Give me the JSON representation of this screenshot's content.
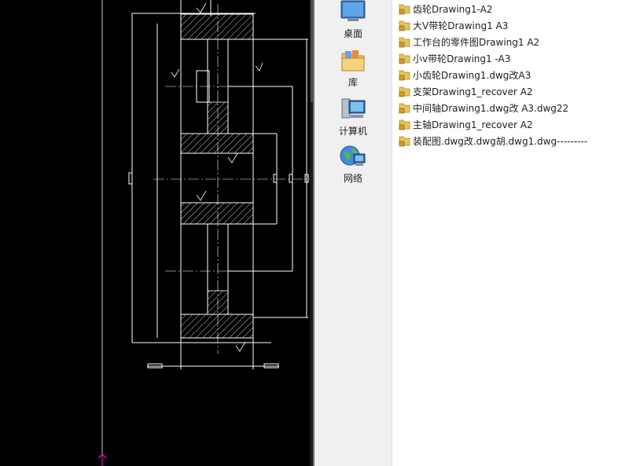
{
  "nav": {
    "items": [
      {
        "label": "桌面",
        "icon": "desktop-icon"
      },
      {
        "label": "库",
        "icon": "library-icon"
      },
      {
        "label": "计算机",
        "icon": "computer-icon"
      },
      {
        "label": "网络",
        "icon": "network-icon"
      }
    ]
  },
  "files": {
    "items": [
      {
        "label": "齿轮Drawing1-A2"
      },
      {
        "label": "大V带轮Drawing1 A3"
      },
      {
        "label": "工作台的零件图Drawing1 A2"
      },
      {
        "label": "小v带轮Drawing1 -A3"
      },
      {
        "label": "小齿轮Drawing1.dwg改A3"
      },
      {
        "label": "支架Drawing1_recover A2"
      },
      {
        "label": "中间轴Drawing1.dwg改 A3.dwg22"
      },
      {
        "label": "主轴Drawing1_recover A2"
      },
      {
        "label": "装配图.dwg改.dwg胡.dwg1.dwg---------"
      }
    ]
  },
  "colors": {
    "cad_background": "#000000",
    "cad_lines": "#ffffff",
    "ucs_marker": "#ff00ff",
    "folder": "#e8c25a"
  }
}
